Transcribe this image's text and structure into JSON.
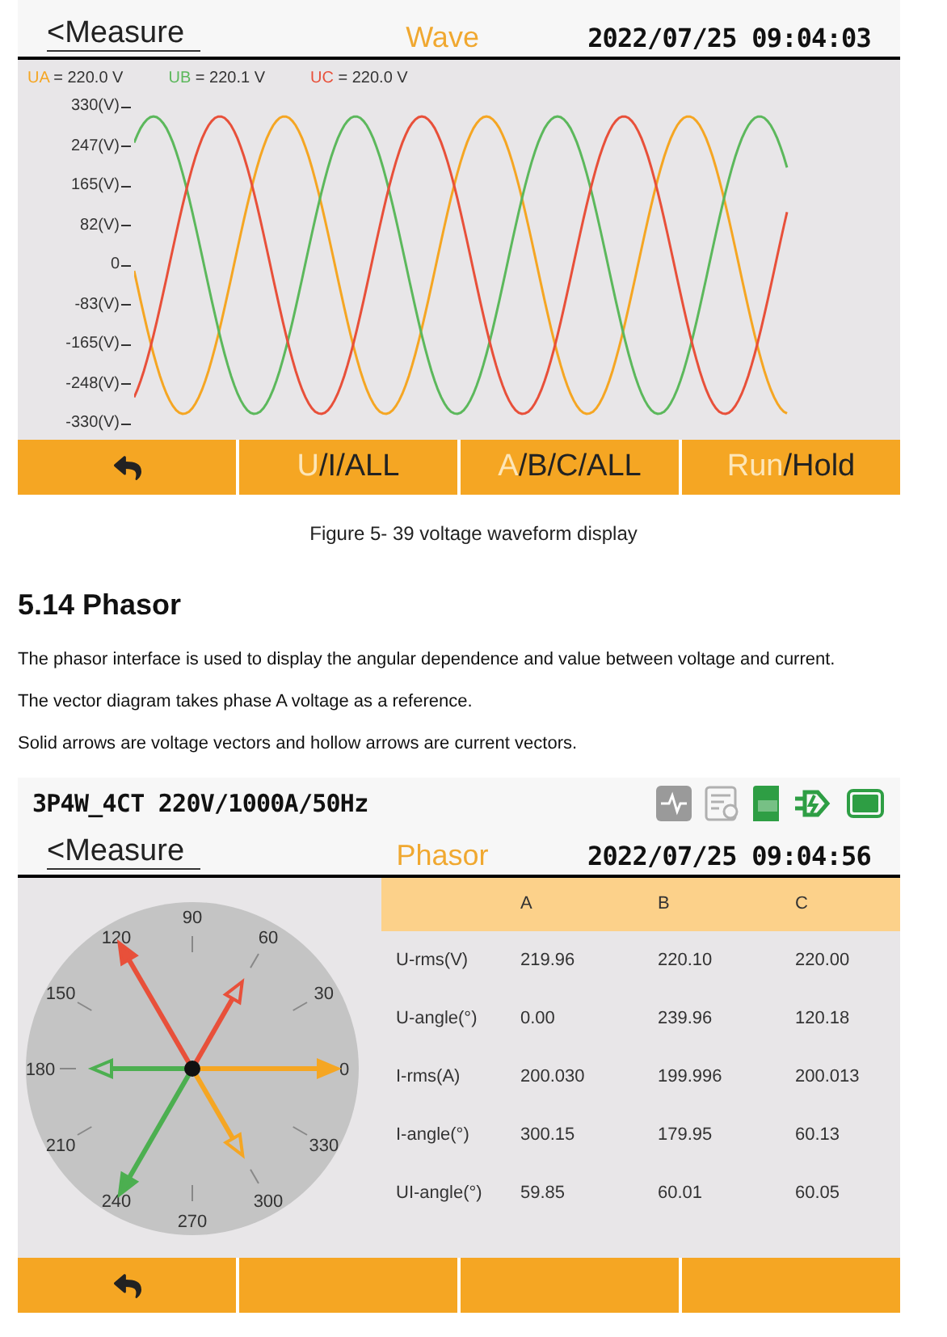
{
  "wave_screen": {
    "back_link": "<Measure",
    "title": "Wave",
    "datetime": "2022/07/25 09:04:03",
    "legend": [
      {
        "label": "UA",
        "value": " = 220.0 V",
        "color": "#f5a623"
      },
      {
        "label": "UB",
        "value": " = 220.1 V",
        "color": "#5cb85c"
      },
      {
        "label": "UC",
        "value": " = 220.0 V",
        "color": "#e8503a"
      }
    ],
    "y_axis_labels": [
      "330(V)",
      "247(V)",
      "165(V)",
      "82(V)",
      "0",
      "-83(V)",
      "-165(V)",
      "-248(V)",
      "-330(V)"
    ],
    "buttons": [
      {
        "kind": "back"
      },
      {
        "kind": "toggle",
        "parts": [
          {
            "text": "U",
            "selected": true
          },
          {
            "text": "/I/ALL",
            "selected": false
          }
        ]
      },
      {
        "kind": "toggle",
        "parts": [
          {
            "text": "A",
            "selected": true
          },
          {
            "text": "/B/C/ALL",
            "selected": false
          }
        ]
      },
      {
        "kind": "toggle",
        "parts": [
          {
            "text": "Run",
            "selected": true
          },
          {
            "text": "/Hold",
            "selected": false
          }
        ]
      }
    ]
  },
  "caption": "Figure 5- 39 voltage waveform display",
  "section_heading": "5.14 Phasor",
  "paragraphs": [
    "The phasor interface is used to display the angular dependence and value between voltage and current.",
    "The vector diagram takes phase A voltage as a reference.",
    "Solid arrows are voltage vectors and hollow arrows are current vectors."
  ],
  "phasor_screen": {
    "wiring": "3P4W_4CT 220V/1000A/50Hz",
    "status_icons": [
      {
        "kind": "waveform",
        "color": "#9a9a9a"
      },
      {
        "kind": "record",
        "color": "#b0b0b0"
      },
      {
        "kind": "tf-card",
        "color": "#2e9e44"
      },
      {
        "kind": "plug",
        "color": "#2e9e44"
      },
      {
        "kind": "battery",
        "color": "#2e9e44"
      }
    ],
    "back_link": "<Measure",
    "title": "Phasor",
    "datetime": "2022/07/25 09:04:56",
    "dial_labels": [
      "0",
      "30",
      "60",
      "90",
      "120",
      "150",
      "180",
      "210",
      "240",
      "270",
      "300",
      "330"
    ],
    "voltage_vectors": [
      {
        "color": "#f5a623"
      },
      {
        "color": "#4caf50"
      },
      {
        "color": "#e8503a"
      }
    ],
    "current_vectors": [
      {
        "color": "#f5a623"
      },
      {
        "color": "#4caf50"
      },
      {
        "color": "#e8503a"
      }
    ],
    "table": {
      "columns": [
        "A",
        "B",
        "C"
      ],
      "rows": [
        {
          "label": "U-rms(V)",
          "cells": [
            "219.96",
            "220.10",
            "220.00"
          ]
        },
        {
          "label": "U-angle(°)",
          "cells": [
            "0.00",
            "239.96",
            "120.18"
          ]
        },
        {
          "label": "I-rms(A)",
          "cells": [
            "200.030",
            "199.996",
            "200.013"
          ]
        },
        {
          "label": "I-angle(°)",
          "cells": [
            "300.15",
            "179.95",
            "60.13"
          ]
        },
        {
          "label": "UI-angle(°)",
          "cells": [
            "59.85",
            "60.01",
            "60.05"
          ]
        }
      ]
    },
    "buttons": [
      {
        "kind": "back"
      },
      {
        "kind": "blank"
      },
      {
        "kind": "blank"
      },
      {
        "kind": "blank"
      }
    ]
  }
}
